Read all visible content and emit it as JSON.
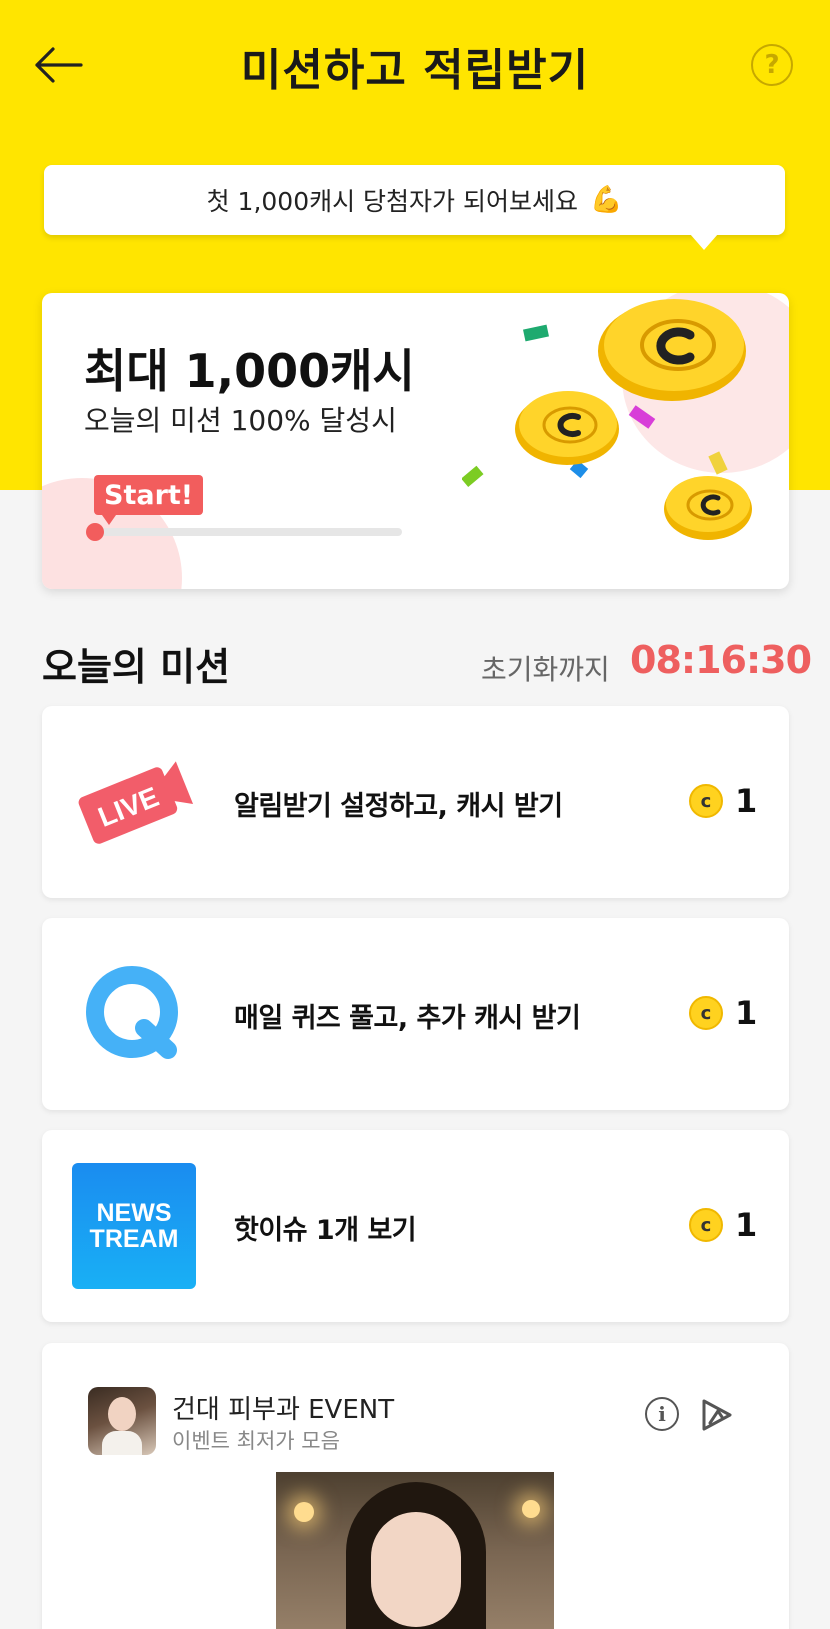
{
  "header": {
    "title": "미션하고 적립받기",
    "help_glyph": "?",
    "back_icon": "arrow-left-icon"
  },
  "promo": {
    "text": "첫 1,000캐시 당첨자가 되어보세요",
    "emoji": "💪"
  },
  "hero": {
    "title": "최대 1,000캐시",
    "subtitle": "오늘의 미션 100% 달성시",
    "badge": "Start!",
    "progress": 0
  },
  "missions_section": {
    "title": "오늘의 미션",
    "reset_label": "초기화까지",
    "reset_time": "08:16:30"
  },
  "missions": [
    {
      "icon": "live-icon",
      "icon_text": "LIVE",
      "label": "알림받기 설정하고, 캐시 받기",
      "reward": "1",
      "coin_glyph": "c"
    },
    {
      "icon": "quiz-q-icon",
      "icon_text": "Q",
      "label": "매일 퀴즈 풀고, 추가 캐시 받기",
      "reward": "1",
      "coin_glyph": "c"
    },
    {
      "icon": "newstream-logo",
      "icon_text_1": "NEWS",
      "icon_text_2": "TREAM",
      "label": "핫이슈 1개 보기",
      "reward": "1",
      "coin_glyph": "c"
    }
  ],
  "ad": {
    "title": "건대 피부과 EVENT",
    "subtitle": "이벤트 최저가 모음",
    "info_glyph": "i"
  },
  "colors": {
    "brand_yellow": "#ffe500",
    "accent_red": "#ee5f5f",
    "coin_gold": "#ffd21f",
    "news_blue": "#1a8cf0",
    "quiz_blue": "#45b1f7"
  }
}
